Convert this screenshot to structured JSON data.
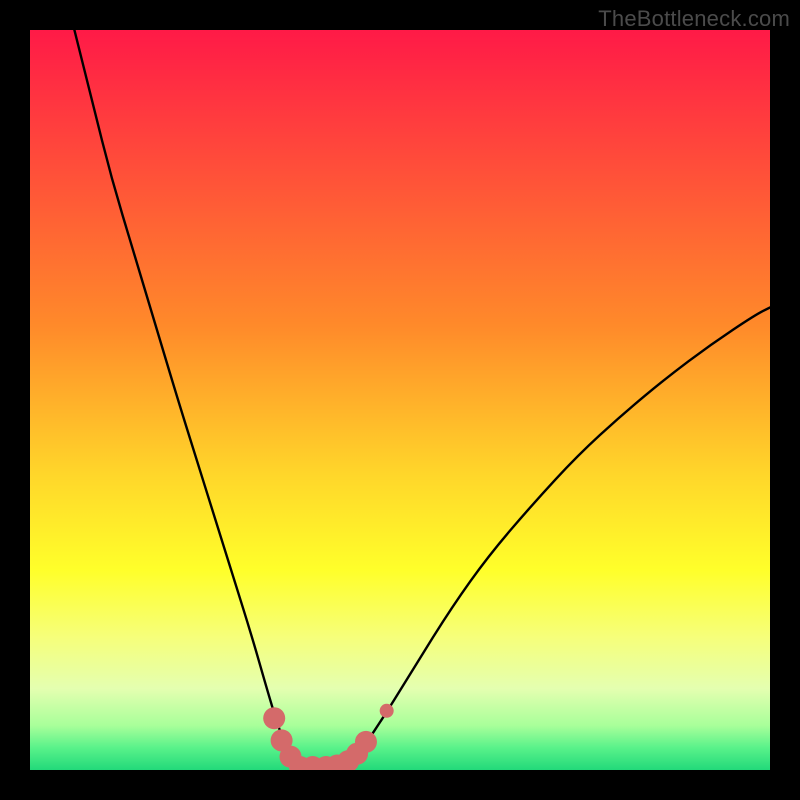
{
  "watermark": "TheBottleneck.com",
  "chart_data": {
    "type": "line",
    "title": "",
    "xlabel": "",
    "ylabel": "",
    "xlim": [
      0,
      100
    ],
    "ylim": [
      0,
      100
    ],
    "grid": false,
    "legend": false,
    "background_gradient": {
      "stops": [
        {
          "offset": 0.0,
          "color": "#ff1a47"
        },
        {
          "offset": 0.4,
          "color": "#ff8a2a"
        },
        {
          "offset": 0.6,
          "color": "#ffd62a"
        },
        {
          "offset": 0.73,
          "color": "#ffff2a"
        },
        {
          "offset": 0.82,
          "color": "#f6ff7a"
        },
        {
          "offset": 0.89,
          "color": "#e4ffb0"
        },
        {
          "offset": 0.94,
          "color": "#a8ff9a"
        },
        {
          "offset": 0.97,
          "color": "#59f28a"
        },
        {
          "offset": 1.0,
          "color": "#22d97a"
        }
      ]
    },
    "series": [
      {
        "name": "bottleneck-curve",
        "color": "#000000",
        "width": 2.4,
        "points": [
          {
            "x": 6.0,
            "y": 100.0
          },
          {
            "x": 8.5,
            "y": 90.0
          },
          {
            "x": 11.0,
            "y": 80.0
          },
          {
            "x": 14.0,
            "y": 70.0
          },
          {
            "x": 17.0,
            "y": 60.0
          },
          {
            "x": 20.0,
            "y": 50.0
          },
          {
            "x": 22.5,
            "y": 42.0
          },
          {
            "x": 25.0,
            "y": 34.0
          },
          {
            "x": 27.5,
            "y": 26.0
          },
          {
            "x": 30.0,
            "y": 18.0
          },
          {
            "x": 32.0,
            "y": 11.0
          },
          {
            "x": 33.5,
            "y": 6.0
          },
          {
            "x": 35.0,
            "y": 2.0
          },
          {
            "x": 36.5,
            "y": 0.4
          },
          {
            "x": 39.0,
            "y": 0.4
          },
          {
            "x": 41.0,
            "y": 0.4
          },
          {
            "x": 43.0,
            "y": 1.0
          },
          {
            "x": 45.0,
            "y": 3.0
          },
          {
            "x": 48.0,
            "y": 7.5
          },
          {
            "x": 52.0,
            "y": 14.0
          },
          {
            "x": 57.0,
            "y": 22.0
          },
          {
            "x": 62.0,
            "y": 29.0
          },
          {
            "x": 68.0,
            "y": 36.0
          },
          {
            "x": 74.0,
            "y": 42.5
          },
          {
            "x": 80.0,
            "y": 48.0
          },
          {
            "x": 86.0,
            "y": 53.0
          },
          {
            "x": 92.0,
            "y": 57.5
          },
          {
            "x": 98.0,
            "y": 61.5
          },
          {
            "x": 100.0,
            "y": 62.5
          }
        ]
      }
    ],
    "markers": {
      "color": "#d46a6a",
      "radius_large": 11,
      "radius_small": 7,
      "points": [
        {
          "x": 33.0,
          "y": 7.0,
          "size": "large"
        },
        {
          "x": 34.0,
          "y": 4.0,
          "size": "large"
        },
        {
          "x": 35.2,
          "y": 1.8,
          "size": "large"
        },
        {
          "x": 36.5,
          "y": 0.4,
          "size": "large"
        },
        {
          "x": 38.2,
          "y": 0.4,
          "size": "large"
        },
        {
          "x": 40.0,
          "y": 0.4,
          "size": "large"
        },
        {
          "x": 41.5,
          "y": 0.6,
          "size": "large"
        },
        {
          "x": 43.0,
          "y": 1.2,
          "size": "large"
        },
        {
          "x": 44.2,
          "y": 2.2,
          "size": "large"
        },
        {
          "x": 45.4,
          "y": 3.8,
          "size": "large"
        },
        {
          "x": 48.2,
          "y": 8.0,
          "size": "small"
        }
      ]
    }
  }
}
